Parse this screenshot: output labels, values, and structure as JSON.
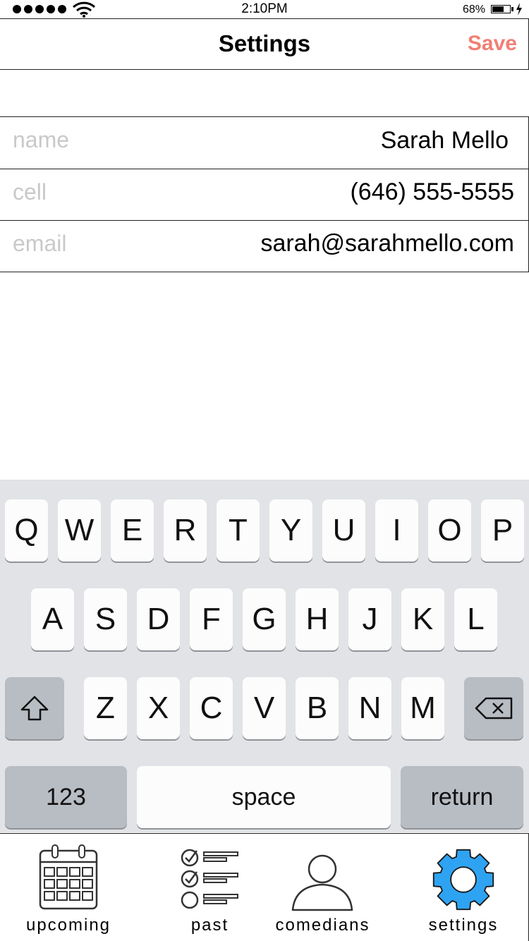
{
  "status_bar": {
    "time": "2:10PM",
    "battery_percent": "68%",
    "battery_level": 0.68,
    "signal_bars": 5
  },
  "nav": {
    "title": "Settings",
    "save_label": "Save",
    "accent_color": "#f07f75"
  },
  "form": {
    "rows": [
      {
        "label": "name",
        "value": "Sarah Mello"
      },
      {
        "label": "cell",
        "value": "(646) 555-5555"
      },
      {
        "label": "email",
        "value": "sarah@sarahmello.com"
      }
    ]
  },
  "keyboard": {
    "row1": [
      "Q",
      "W",
      "E",
      "R",
      "T",
      "Y",
      "U",
      "I",
      "O",
      "P"
    ],
    "row2": [
      "A",
      "S",
      "D",
      "F",
      "G",
      "H",
      "J",
      "K",
      "L"
    ],
    "row3": [
      "Z",
      "X",
      "C",
      "V",
      "B",
      "N",
      "M"
    ],
    "numbers_label": "123",
    "space_label": "space",
    "return_label": "return",
    "shift_icon": "shift-icon",
    "delete_icon": "backspace-icon"
  },
  "tab_bar": {
    "active_color": "#2ea3f2",
    "tabs": [
      {
        "label": "upcoming",
        "icon": "calendar-icon"
      },
      {
        "label": "past",
        "icon": "checklist-icon"
      },
      {
        "label": "comedians",
        "icon": "person-icon"
      },
      {
        "label": "settings",
        "icon": "gear-icon",
        "active": true
      }
    ]
  }
}
